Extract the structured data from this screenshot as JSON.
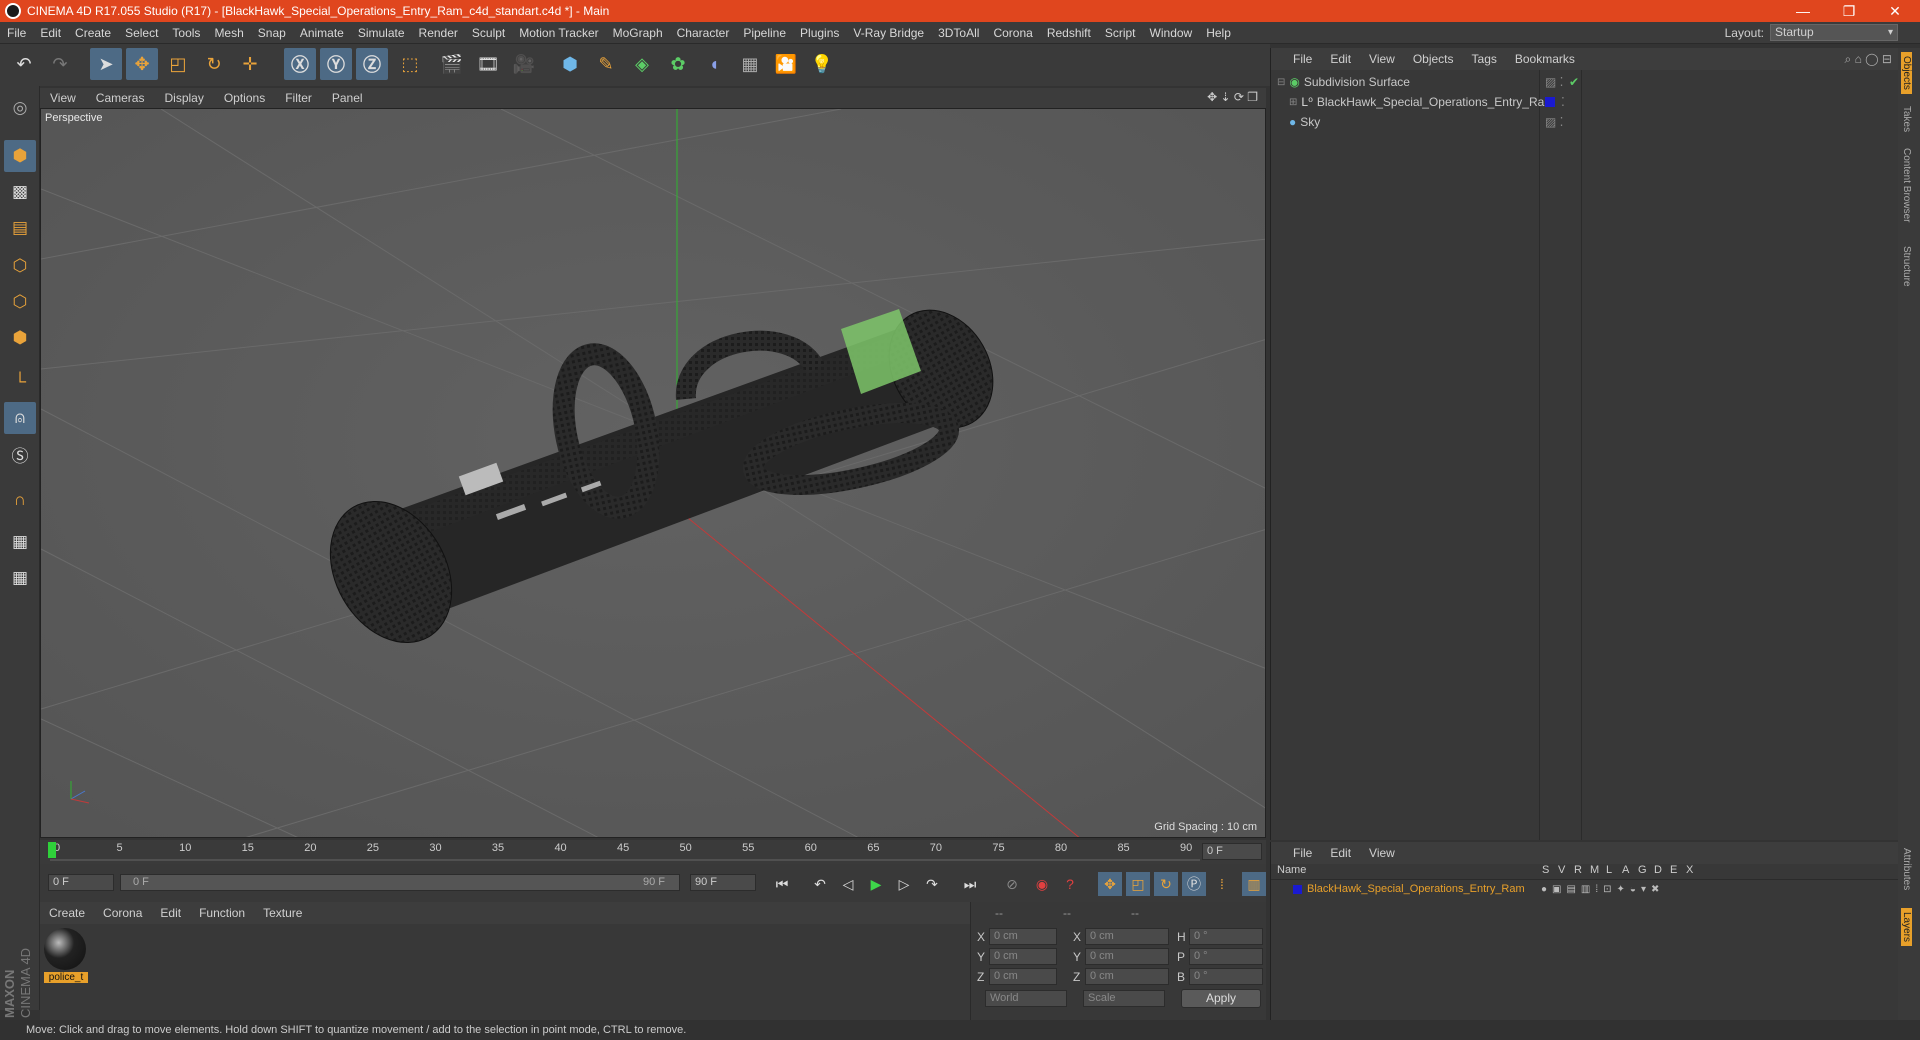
{
  "window": {
    "title": "CINEMA 4D R17.055 Studio (R17) - [BlackHawk_Special_Operations_Entry_Ram_c4d_standart.c4d *] - Main",
    "controls": [
      "—",
      "❐",
      "✕"
    ]
  },
  "menubar": [
    "File",
    "Edit",
    "Create",
    "Select",
    "Tools",
    "Mesh",
    "Snap",
    "Animate",
    "Simulate",
    "Render",
    "Sculpt",
    "Motion Tracker",
    "MoGraph",
    "Character",
    "Pipeline",
    "Plugins",
    "V-Ray Bridge",
    "3DToAll",
    "Corona",
    "Redshift",
    "Script",
    "Window",
    "Help"
  ],
  "layout": {
    "label": "Layout:",
    "value": "Startup"
  },
  "viewport": {
    "menu": [
      "View",
      "Cameras",
      "Display",
      "Options",
      "Filter",
      "Panel"
    ],
    "label": "Perspective",
    "grid_spacing": "Grid Spacing : 10 cm"
  },
  "timeline": {
    "ticks": [
      "0",
      "5",
      "10",
      "15",
      "20",
      "25",
      "30",
      "35",
      "40",
      "45",
      "50",
      "55",
      "60",
      "65",
      "70",
      "75",
      "80",
      "85",
      "90"
    ],
    "current_frame": "0 F",
    "start": "0 F",
    "range_start": "0 F",
    "range_end": "90 F",
    "end": "90 F"
  },
  "material_manager": {
    "menu": [
      "Create",
      "Corona",
      "Edit",
      "Function",
      "Texture"
    ],
    "materials": [
      {
        "name": "police_t"
      }
    ]
  },
  "coordinates": {
    "headers": [
      "--",
      "--",
      "--"
    ],
    "rows": [
      {
        "a": "X",
        "av": "0 cm",
        "b": "X",
        "bv": "0 cm",
        "c": "H",
        "cv": "0 °"
      },
      {
        "a": "Y",
        "av": "0 cm",
        "b": "Y",
        "bv": "0 cm",
        "c": "P",
        "cv": "0 °"
      },
      {
        "a": "Z",
        "av": "0 cm",
        "b": "Z",
        "bv": "0 cm",
        "c": "B",
        "cv": "0 °"
      }
    ],
    "mode1": "World",
    "mode2": "Scale",
    "apply": "Apply"
  },
  "object_manager": {
    "menu": [
      "File",
      "Edit",
      "View",
      "Objects",
      "Tags",
      "Bookmarks"
    ],
    "objects": [
      {
        "name": "Subdivision Surface",
        "indent": 0
      },
      {
        "name": "BlackHawk_Special_Operations_Entry_Ram",
        "indent": 1
      },
      {
        "name": "Sky",
        "indent": 0
      }
    ]
  },
  "layer_manager": {
    "menu": [
      "File",
      "Edit",
      "View"
    ],
    "columns": [
      "Name",
      "S",
      "V",
      "R",
      "M",
      "L",
      "A",
      "G",
      "D",
      "E",
      "X"
    ],
    "layers": [
      {
        "name": "BlackHawk_Special_Operations_Entry_Ram",
        "color": "#1a1ad0"
      }
    ]
  },
  "right_tabs": [
    "Objects",
    "Takes",
    "Content Browser",
    "Structure"
  ],
  "right_tabs_bottom": [
    "Attributes",
    "Layers"
  ],
  "status": "Move: Click and drag to move elements. Hold down SHIFT to quantize movement / add to the selection in point mode, CTRL to remove.",
  "brand": {
    "line1": "MAXON",
    "line2": "CINEMA 4D"
  },
  "colors": {
    "accent": "#e0461e",
    "selection": "#4d6a85",
    "object_label": "#e8a02a"
  }
}
